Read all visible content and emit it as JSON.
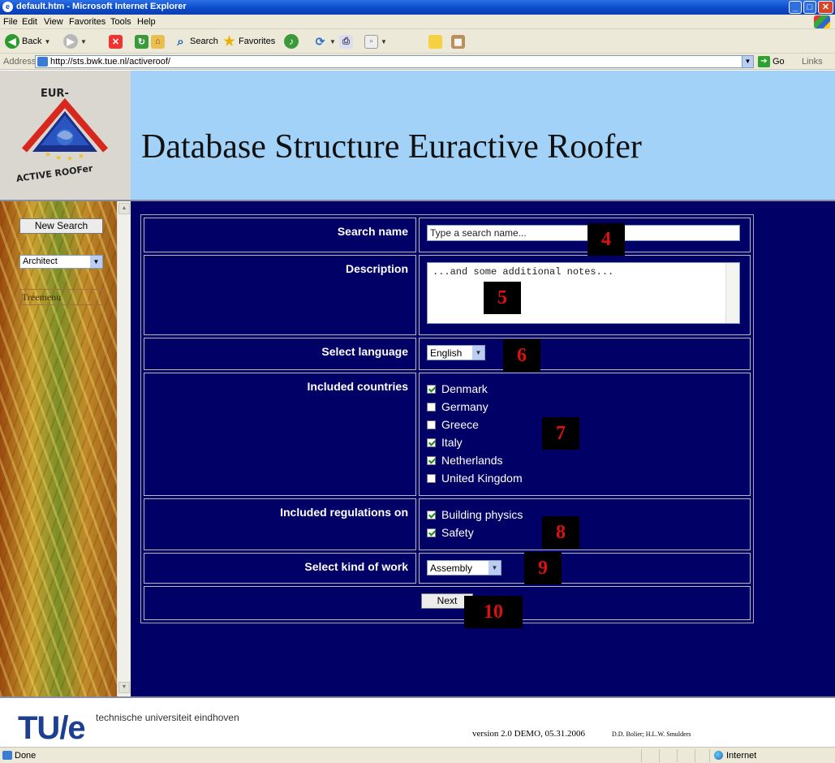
{
  "window": {
    "title": "default.htm - Microsoft Internet Explorer",
    "controls": [
      "minimize",
      "maximize",
      "close"
    ]
  },
  "menu": [
    "File",
    "Edit",
    "View",
    "Favorites",
    "Tools",
    "Help"
  ],
  "toolbar": {
    "back": "Back",
    "search": "Search",
    "favorites": "Favorites"
  },
  "address": {
    "label": "Address",
    "url": "http://sts.bwk.tue.nl/activeroof/",
    "go": "Go",
    "links": "Links"
  },
  "logo": {
    "top_text": "EUR-",
    "bottom_text": "ACTIVE ROOFer"
  },
  "banner": {
    "title": "Database Structure Euractive Roofer"
  },
  "sidebar": {
    "new_search": "New Search",
    "role_selected": "Architect",
    "treemenu": "Treemenu"
  },
  "form": {
    "search_name": {
      "label": "Search name",
      "value": "Type a search name..."
    },
    "description": {
      "label": "Description",
      "value": "...and some additional notes..."
    },
    "language": {
      "label": "Select language",
      "value": "English"
    },
    "countries": {
      "label": "Included countries",
      "items": [
        {
          "name": "Denmark",
          "checked": true
        },
        {
          "name": "Germany",
          "checked": false
        },
        {
          "name": "Greece",
          "checked": false
        },
        {
          "name": "Italy",
          "checked": true
        },
        {
          "name": "Netherlands",
          "checked": true
        },
        {
          "name": "United Kingdom",
          "checked": false
        }
      ]
    },
    "regulations": {
      "label": "Included regulations on",
      "items": [
        {
          "name": "Building physics",
          "checked": true
        },
        {
          "name": "Safety",
          "checked": true
        }
      ]
    },
    "kind_of_work": {
      "label": "Select kind of work",
      "value": "Assembly"
    },
    "next": "Next"
  },
  "badges": [
    "4",
    "5",
    "6",
    "7",
    "8",
    "9",
    "10"
  ],
  "footer": {
    "logo": "TU/e",
    "university": "technische universiteit eindhoven",
    "version": "version 2.0 DEMO, 05.31.2006",
    "authors": "D.D. Bolier; H.L.W. Smulders"
  },
  "status": {
    "left": "Done",
    "zone": "Internet"
  },
  "colors": {
    "banner": "#a3d2f8",
    "main_bg": "#000066",
    "badge_text": "#dd1111",
    "title_bar": "#0a49c8"
  }
}
